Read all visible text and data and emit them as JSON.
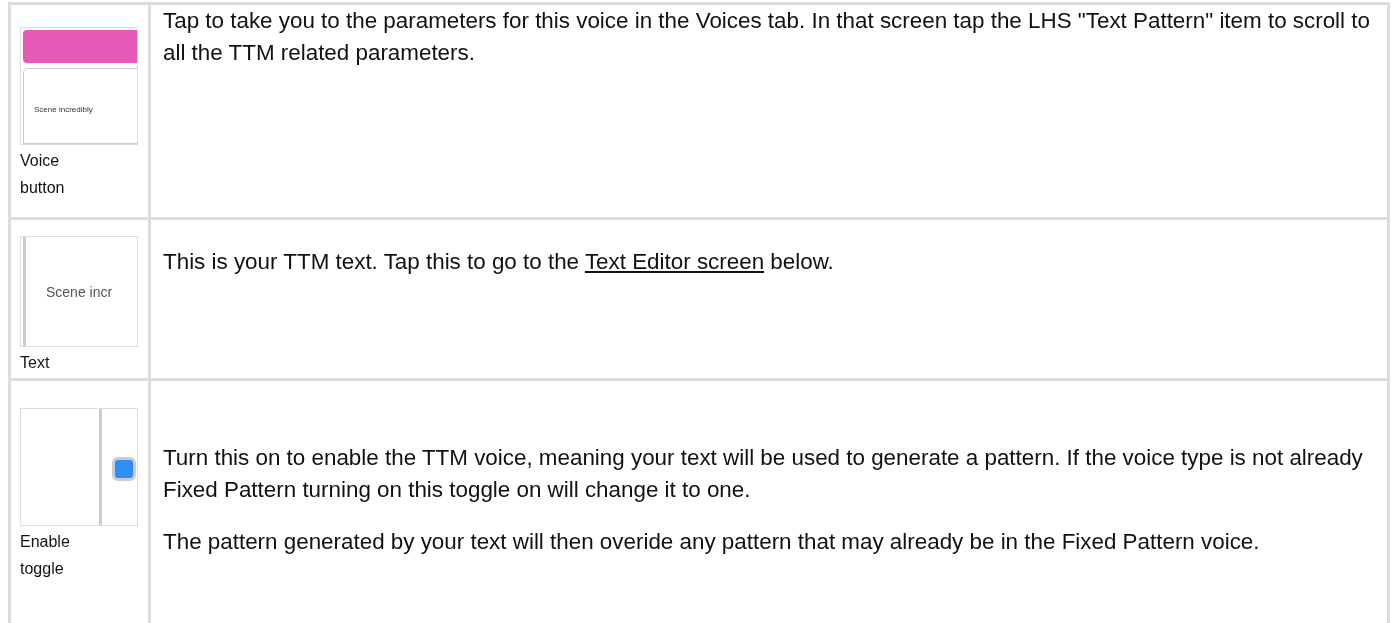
{
  "rows": [
    {
      "thumbnail": {
        "kind": "voice_button",
        "text": "Scene incredibly"
      },
      "caption": "Voice button",
      "paragraphs": [
        [
          {
            "kind": "text",
            "text": "Tap to take you to the parameters for this voice in the Voices tab. In that screen tap the LHS \"Text Pattern\" item to scroll to all the TTM related parameters."
          }
        ]
      ]
    },
    {
      "thumbnail": {
        "kind": "text_field",
        "text": "Scene incr"
      },
      "caption": "Text",
      "paragraphs": [
        [
          {
            "kind": "text",
            "text": "This is your TTM text. Tap this to go to the "
          },
          {
            "kind": "link",
            "text": "Text Editor screen"
          },
          {
            "kind": "text",
            "text": " below."
          }
        ]
      ]
    },
    {
      "thumbnail": {
        "kind": "toggle",
        "on": true
      },
      "caption": "Enable toggle",
      "paragraphs": [
        [
          {
            "kind": "text",
            "text": "Turn this on to enable the TTM voice, meaning your text will be used to generate a pattern. If the voice type is not already Fixed Pattern turning on this toggle on will change it to one."
          }
        ],
        [
          {
            "kind": "text",
            "text": "The pattern generated by your text will then overide any pattern that may already be in the Fixed Pattern voice."
          }
        ]
      ]
    }
  ]
}
